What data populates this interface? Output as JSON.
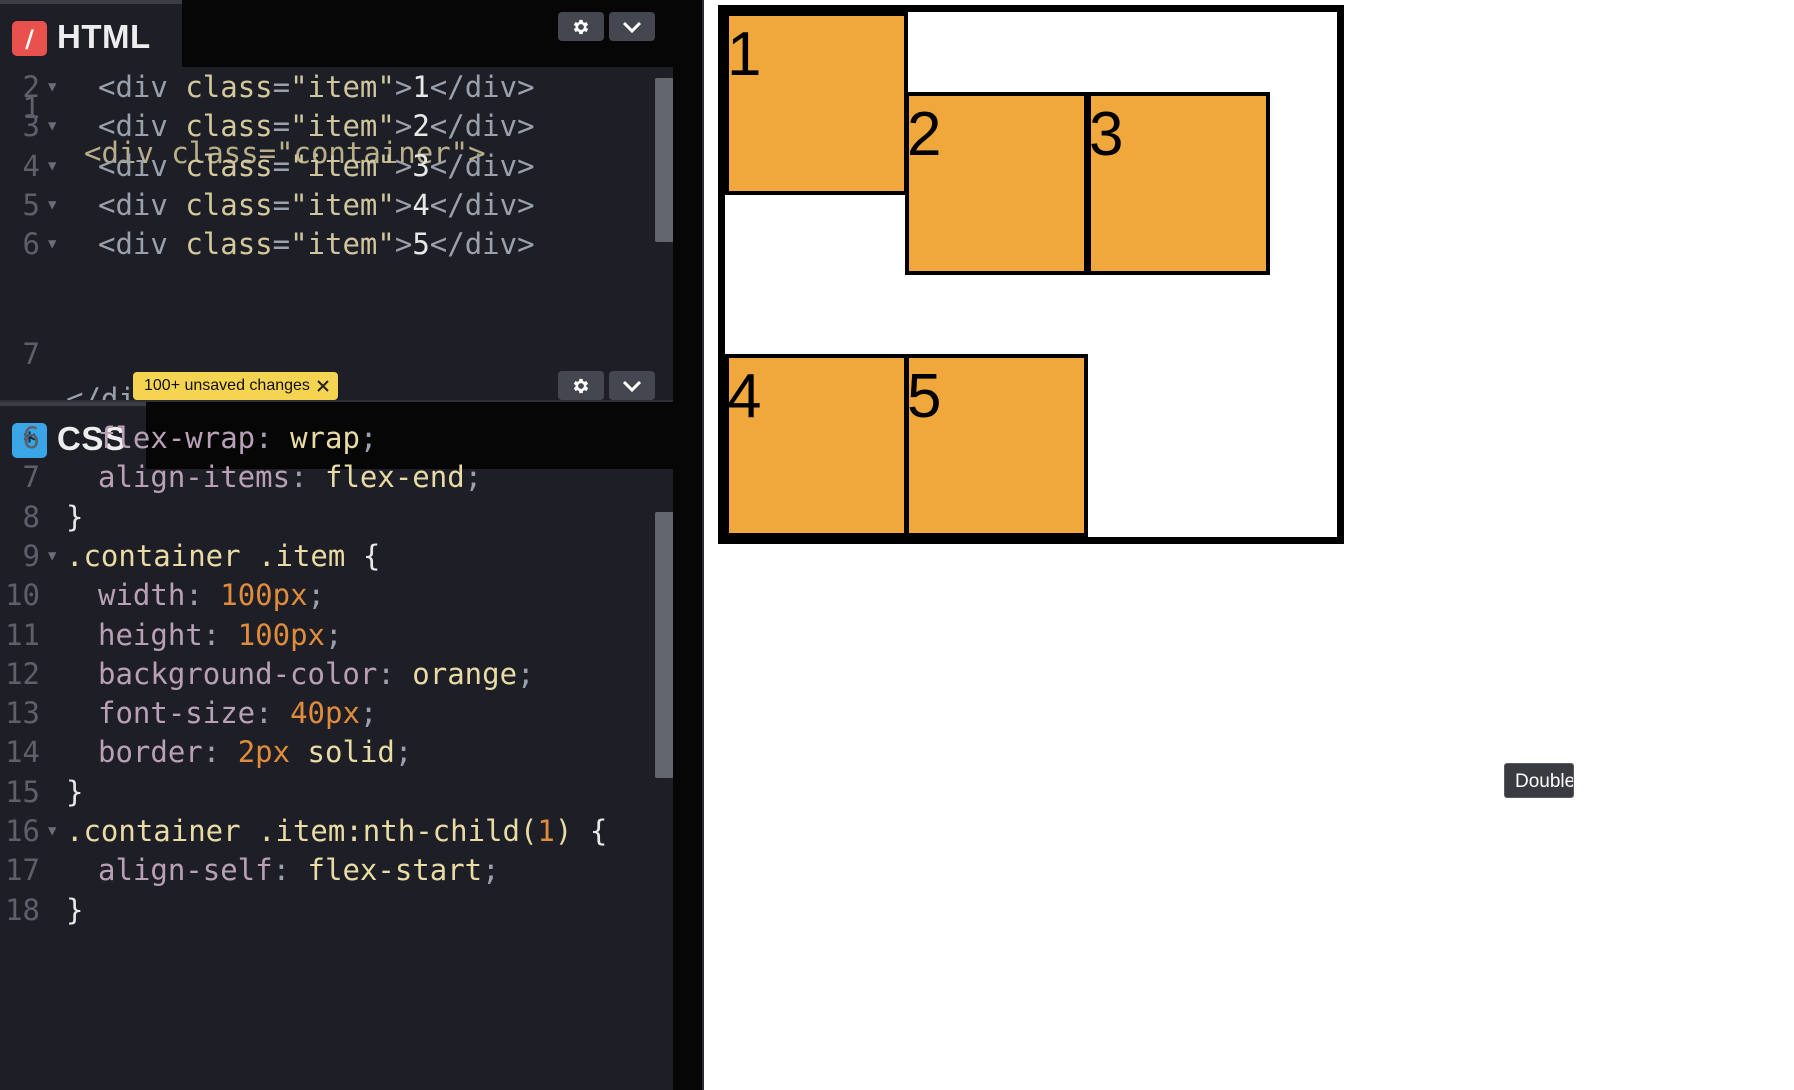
{
  "html_pane": {
    "title": "HTML",
    "badge_glyph": "/",
    "top_partial_line": "<div class=\"container\">",
    "lines": [
      {
        "n": "2",
        "fold": true,
        "indent": "  ",
        "tag_open": "<div",
        "attr": "class",
        "eq": "=",
        "str": "\"item\"",
        "close": ">",
        "text": "1",
        "tag_end": "</div>"
      },
      {
        "n": "3",
        "fold": true,
        "indent": "  ",
        "tag_open": "<div",
        "attr": "class",
        "eq": "=",
        "str": "\"item\"",
        "close": ">",
        "text": "2",
        "tag_end": "</div>"
      },
      {
        "n": "4",
        "fold": true,
        "indent": "  ",
        "tag_open": "<div",
        "attr": "class",
        "eq": "=",
        "str": "\"item\"",
        "close": ">",
        "text": "3",
        "tag_end": "</div>"
      },
      {
        "n": "5",
        "fold": true,
        "indent": "  ",
        "tag_open": "<div",
        "attr": "class",
        "eq": "=",
        "str": "\"item\"",
        "close": ">",
        "text": "4",
        "tag_end": "</div>"
      },
      {
        "n": "6",
        "fold": true,
        "indent": "  ",
        "tag_open": "<div",
        "attr": "class",
        "eq": "=",
        "str": "\"item\"",
        "close": ">",
        "text": "5",
        "tag_end": "</div>"
      }
    ],
    "closing_line": {
      "n": "7",
      "text": "</div>"
    }
  },
  "css_pane": {
    "title": "CSS",
    "badge_glyph": "*",
    "unsaved_label": "100+ unsaved changes",
    "lines": [
      {
        "n": "6",
        "prop": "flex-wrap",
        "value": "wrap"
      },
      {
        "n": "7",
        "prop": "align-items",
        "value": "flex-end"
      },
      {
        "n": "8",
        "brace": "}"
      },
      {
        "n": "9",
        "selector": ".container .item",
        "open": "{"
      },
      {
        "n": "10",
        "prop": "width",
        "num": "100px"
      },
      {
        "n": "11",
        "prop": "height",
        "num": "100px"
      },
      {
        "n": "12",
        "prop": "background-color",
        "value": "orange"
      },
      {
        "n": "13",
        "prop": "font-size",
        "num": "40px"
      },
      {
        "n": "14",
        "prop": "border",
        "num": "2px",
        "value": "solid"
      },
      {
        "n": "15",
        "brace": "}"
      },
      {
        "n": "16",
        "selector": ".container .item:nth-child(",
        "sel_num": "1",
        "sel_end": ")",
        "open": "{"
      },
      {
        "n": "17",
        "prop": "align-self",
        "value": "flex-start"
      },
      {
        "n": "18",
        "brace": "}"
      }
    ]
  },
  "preview": {
    "items": [
      "1",
      "2",
      "3",
      "4",
      "5"
    ],
    "item_color": "#f0a83c",
    "tooltip": "Double"
  },
  "icons": {
    "settings": "gear-icon",
    "collapse": "chevron-down-icon",
    "dismiss": "close-icon"
  }
}
